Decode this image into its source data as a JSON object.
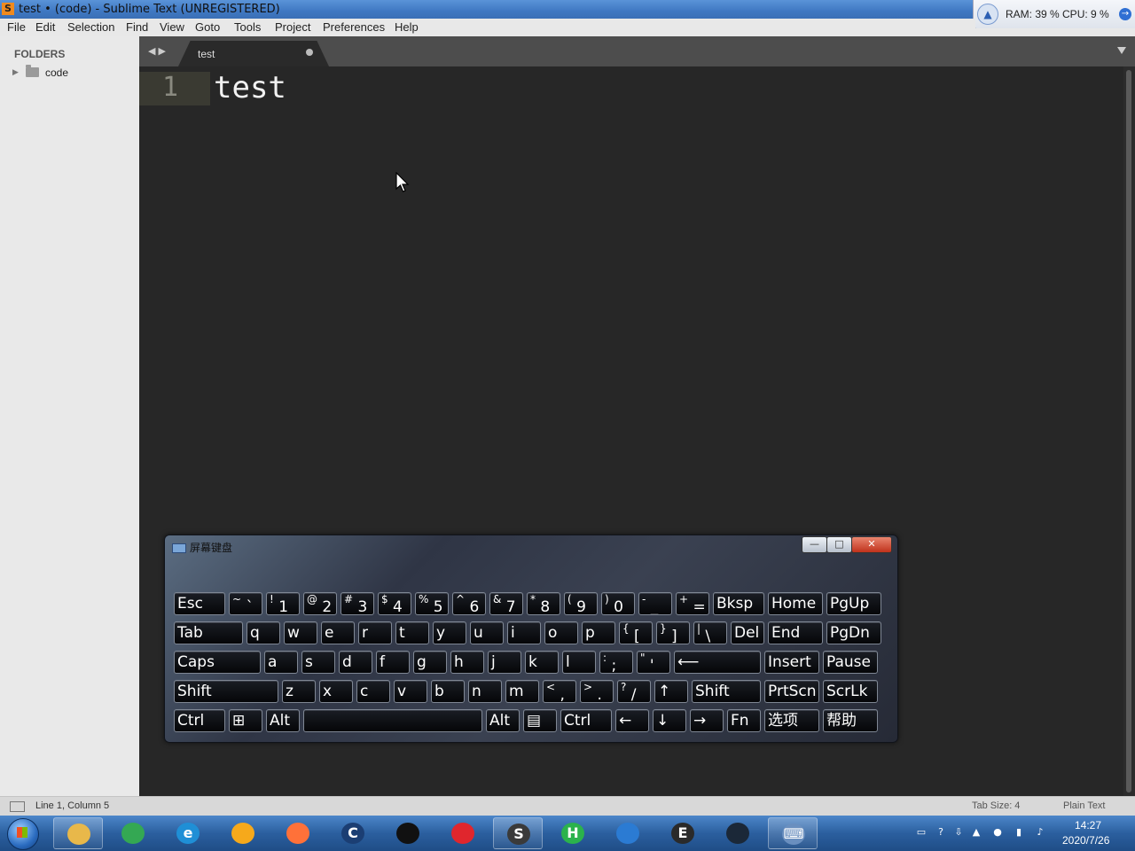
{
  "window": {
    "title": "test • (code) - Sublime Text (UNREGISTERED)",
    "app_icon_glyph": "S"
  },
  "sysmon": {
    "ram_label": "RAM: 39 %",
    "cpu_label": "CPU: 9 %",
    "stats_text": "RAM: 39 %  CPU: 9 %"
  },
  "menu": {
    "items": [
      "File",
      "Edit",
      "Selection",
      "Find",
      "View",
      "Goto",
      "Tools",
      "Project",
      "Preferences",
      "Help"
    ]
  },
  "sidebar": {
    "header": "FOLDERS",
    "folders": [
      {
        "name": "code"
      }
    ]
  },
  "tabs": [
    {
      "label": "test",
      "dirty": true
    }
  ],
  "editor": {
    "lines": [
      {
        "number": "1",
        "text": "test"
      }
    ]
  },
  "status": {
    "position": "Line 1, Column 5",
    "tab_size": "Tab Size: 4",
    "syntax": "Plain Text"
  },
  "osk": {
    "title": "屏幕键盘",
    "minimize": "—",
    "maximize": "□",
    "close": "✕",
    "rows": [
      [
        "Esc",
        "~`",
        "!1",
        "@2",
        "#3",
        "$4",
        "%5",
        "^6",
        "&7",
        "*8",
        "(9",
        ")0",
        "-_",
        "+=",
        "Bksp",
        "Home",
        "PgUp"
      ],
      [
        "Tab",
        "q",
        "w",
        "e",
        "r",
        "t",
        "y",
        "u",
        "i",
        "o",
        "p",
        "{[",
        "}]",
        "|\\",
        "Del",
        "End",
        "PgDn"
      ],
      [
        "Caps",
        "a",
        "s",
        "d",
        "f",
        "g",
        "h",
        "j",
        "k",
        "l",
        ":;",
        "\"'",
        "Enter",
        "Insert",
        "Pause"
      ],
      [
        "Shift",
        "z",
        "x",
        "c",
        "v",
        "b",
        "n",
        "m",
        "<,",
        ">.",
        "?/",
        "↑",
        "Shift",
        "PrtScn",
        "ScrLk"
      ],
      [
        "Ctrl",
        "Win",
        "Alt",
        "",
        "Alt",
        "Menu",
        "Ctrl",
        "←",
        "↓",
        "→",
        "Fn",
        "选项",
        "帮助"
      ]
    ]
  },
  "taskbar": {
    "apps": [
      {
        "name": "explorer",
        "glyph": "",
        "color": "#e8b84a"
      },
      {
        "name": "chrome",
        "glyph": "",
        "color": "#34a853"
      },
      {
        "name": "edge",
        "glyph": "e",
        "color": "#1f8fd6"
      },
      {
        "name": "app-circle",
        "glyph": "",
        "color": "#f6a91b"
      },
      {
        "name": "firefox",
        "glyph": "",
        "color": "#ff7139"
      },
      {
        "name": "ccleaner",
        "glyph": "C",
        "color": "#1b3e73"
      },
      {
        "name": "qq",
        "glyph": "",
        "color": "#111111"
      },
      {
        "name": "netease-music",
        "glyph": "",
        "color": "#e0262d"
      },
      {
        "name": "sublime",
        "glyph": "S",
        "color": "#3a3a3a"
      },
      {
        "name": "hbuilder",
        "glyph": "H",
        "color": "#2bb24c"
      },
      {
        "name": "vscode",
        "glyph": "",
        "color": "#2b7bd3"
      },
      {
        "name": "epic",
        "glyph": "E",
        "color": "#2a2a2a"
      },
      {
        "name": "steam",
        "glyph": "",
        "color": "#1b2838"
      },
      {
        "name": "osk",
        "glyph": "⌨",
        "color": "#6a8fbf"
      }
    ],
    "time": "14:27",
    "date": "2020/7/26"
  }
}
